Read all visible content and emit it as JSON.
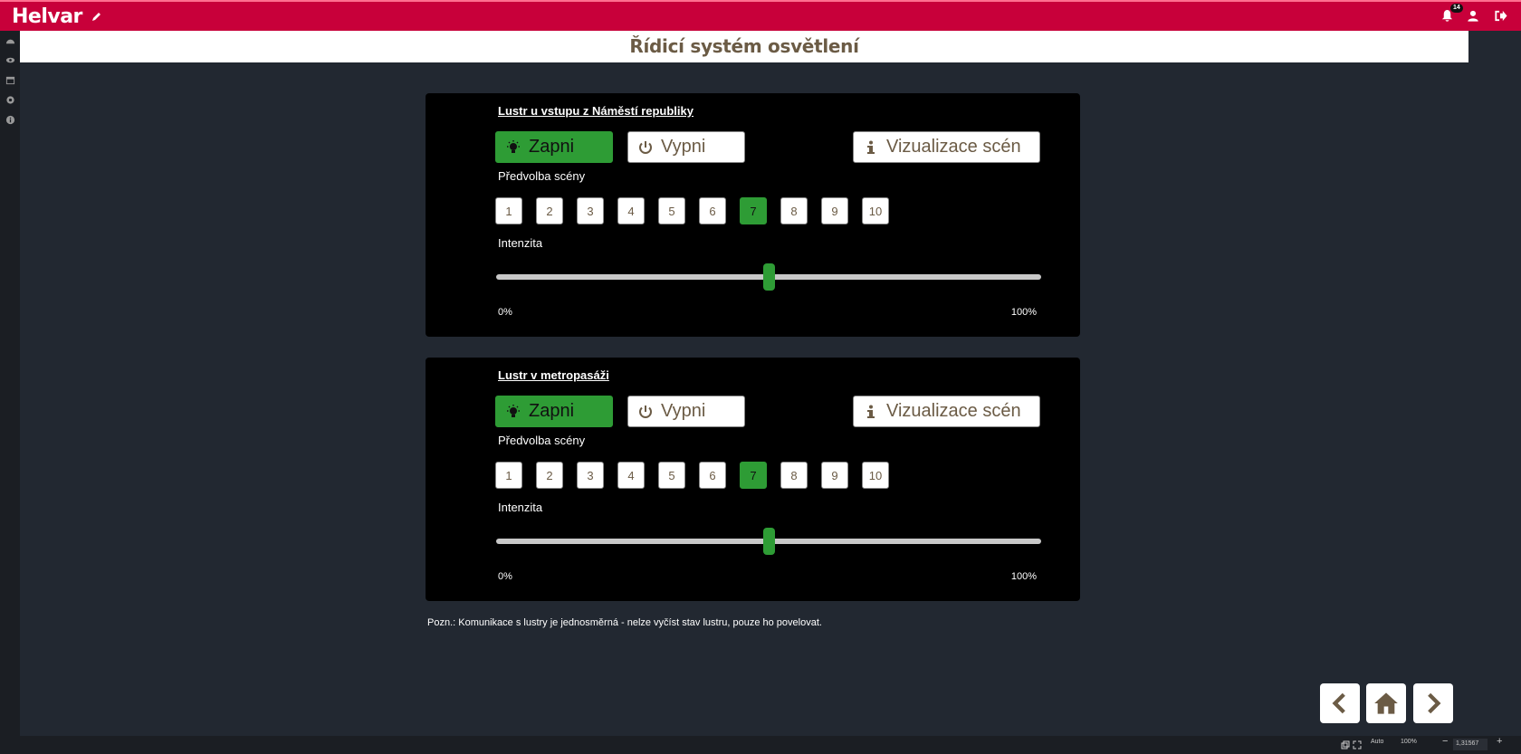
{
  "app": {
    "logo": "Helvar",
    "notification_count": "14"
  },
  "page": {
    "title": "Řídicí systém osvětlení"
  },
  "panels": [
    {
      "title": "Lustr u vstupu z Náměstí republiky",
      "on_label": "Zapni",
      "off_label": "Vypni",
      "viz_label": "Vizualizace scén",
      "preset_label": "Předvolba scény",
      "presets": [
        "1",
        "2",
        "3",
        "4",
        "5",
        "6",
        "7",
        "8",
        "9",
        "10"
      ],
      "active_preset": "7",
      "intensity_label": "Intenzita",
      "intensity_value": 0.5,
      "min_label": "0%",
      "max_label": "100%"
    },
    {
      "title": "Lustr v metropasáži",
      "on_label": "Zapni",
      "off_label": "Vypni",
      "viz_label": "Vizualizace scén",
      "preset_label": "Předvolba scény",
      "presets": [
        "1",
        "2",
        "3",
        "4",
        "5",
        "6",
        "7",
        "8",
        "9",
        "10"
      ],
      "active_preset": "7",
      "intensity_label": "Intenzita",
      "intensity_value": 0.5,
      "min_label": "0%",
      "max_label": "100%"
    }
  ],
  "note": "Pozn.: Komunikace s lustry je jednosměrná - nelze vyčíst stav lustru, pouze ho povelovat.",
  "statusbar": {
    "mode": "Auto",
    "zoom": "100%",
    "scale": "1,31567"
  },
  "colors": {
    "brand": "#c8003a",
    "active": "#2e9c35",
    "text_brown": "#6b5b45"
  },
  "icons": {
    "edit": "pencil-icon",
    "bell": "bell-icon",
    "user": "user-icon",
    "logout": "logout-icon",
    "on": "lightbulb-icon",
    "off": "power-icon",
    "info": "info-icon",
    "back": "chevron-left-icon",
    "home": "home-icon",
    "forward": "chevron-right-icon"
  }
}
